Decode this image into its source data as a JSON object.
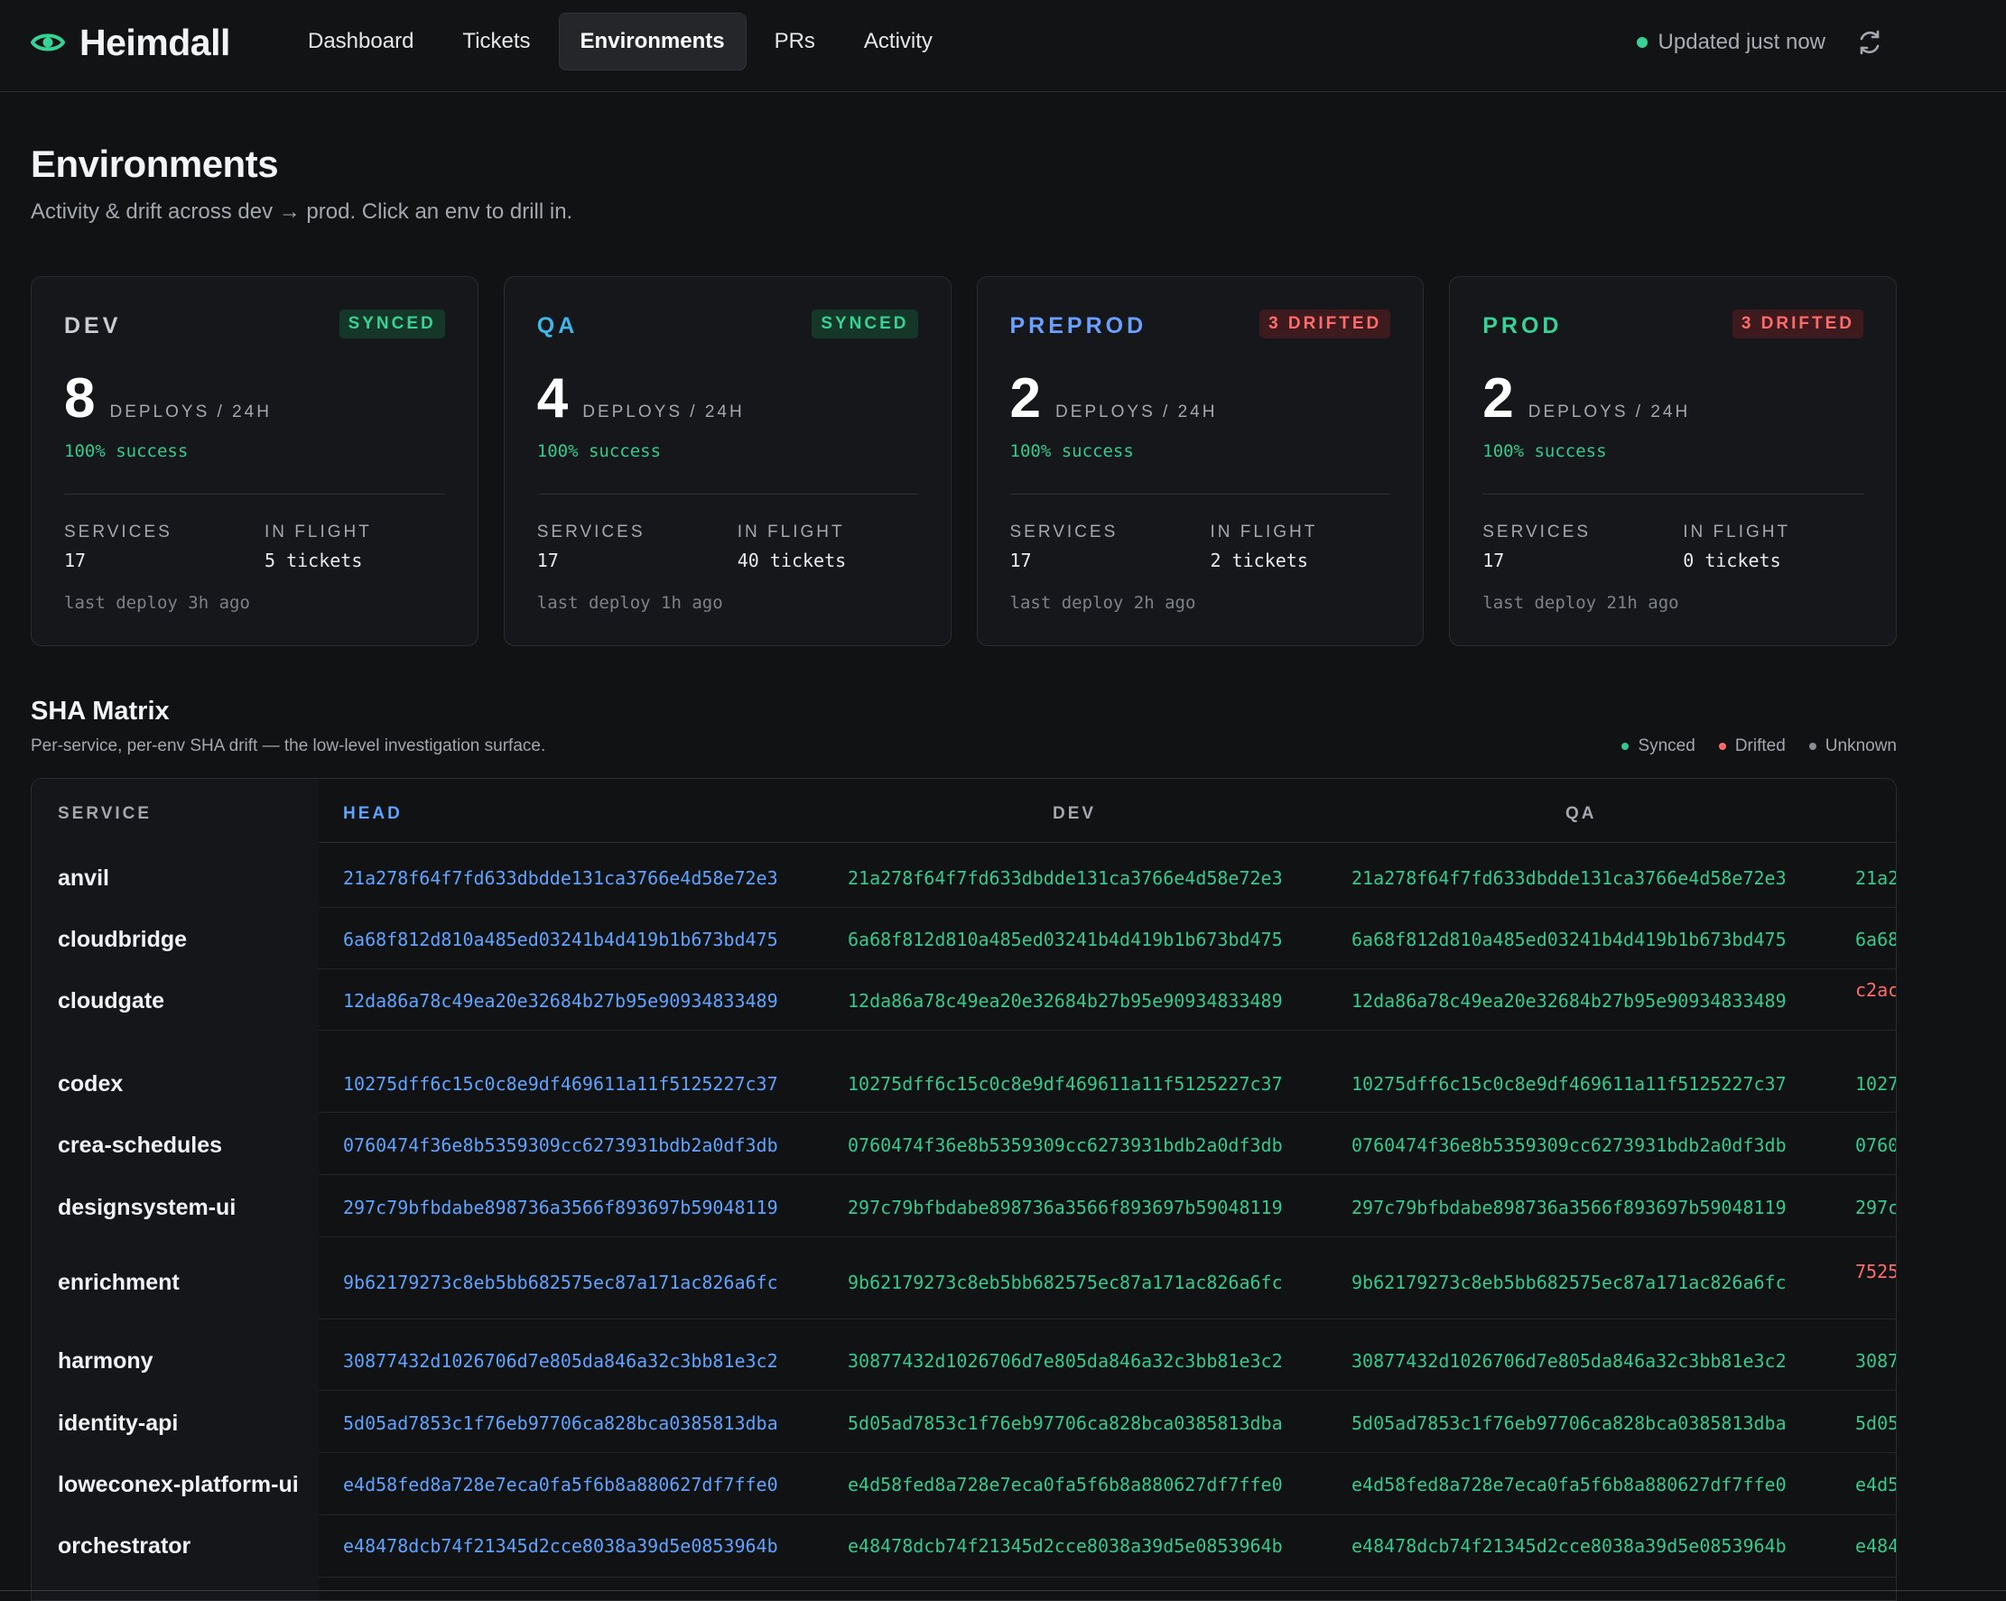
{
  "app": {
    "name": "Heimdall",
    "status": "Updated just now"
  },
  "colors": {
    "accent": "#38d196",
    "head": "#5fa3ff",
    "drifted": "#ff6b6b",
    "unknown": "#8a8d94"
  },
  "nav": [
    {
      "label": "Dashboard"
    },
    {
      "label": "Tickets"
    },
    {
      "label": "Environments",
      "active": true
    },
    {
      "label": "PRs"
    },
    {
      "label": "Activity"
    }
  ],
  "page": {
    "title": "Environments",
    "subtitle": "Activity & drift across dev → prod. Click an env to drill in."
  },
  "envs": [
    {
      "name": "DEV",
      "color": "#c9ccd1",
      "badge": "SYNCED",
      "deploys": "8",
      "deploys_label": "DEPLOYS / 24H",
      "success": "100% success",
      "services_label": "SERVICES",
      "services": "17",
      "inflight_label": "IN FLIGHT",
      "inflight": "5 tickets",
      "last_deploy": "last deploy 3h ago"
    },
    {
      "name": "QA",
      "color": "#3fb6e8",
      "badge": "SYNCED",
      "deploys": "4",
      "deploys_label": "DEPLOYS / 24H",
      "success": "100% success",
      "services_label": "SERVICES",
      "services": "17",
      "inflight_label": "IN FLIGHT",
      "inflight": "40 tickets",
      "last_deploy": "last deploy 1h ago"
    },
    {
      "name": "PREPROD",
      "color": "#6aa0ff",
      "badge": "3 DRIFTED",
      "deploys": "2",
      "deploys_label": "DEPLOYS / 24H",
      "success": "100% success",
      "services_label": "SERVICES",
      "services": "17",
      "inflight_label": "IN FLIGHT",
      "inflight": "2 tickets",
      "last_deploy": "last deploy 2h ago"
    },
    {
      "name": "PROD",
      "color": "#38d196",
      "badge": "3 DRIFTED",
      "deploys": "2",
      "deploys_label": "DEPLOYS / 24H",
      "success": "100% success",
      "services_label": "SERVICES",
      "services": "17",
      "inflight_label": "IN FLIGHT",
      "inflight": "0 tickets",
      "last_deploy": "last deploy 21h ago"
    }
  ],
  "sha_matrix": {
    "title": "SHA Matrix",
    "subtitle": "Per-service, per-env SHA drift — the low-level investigation surface.",
    "legend": [
      {
        "label": "Synced",
        "color": "#35c98e"
      },
      {
        "label": "Drifted",
        "color": "#ff6b6b"
      },
      {
        "label": "Unknown",
        "color": "#8a8d94"
      }
    ],
    "columns": {
      "service": "SERVICE",
      "head": "HEAD",
      "dev": "DEV",
      "qa": "QA"
    },
    "rows": [
      {
        "service": "anvil",
        "head": "21a278f64f7fd633dbdde131ca3766e4d58e72e3",
        "dev": "21a278f64f7fd633dbdde131ca3766e4d58e72e3",
        "qa": "21a278f64f7fd633dbdde131ca3766e4d58e72e3",
        "next": "21a2",
        "next_state": "synced"
      },
      {
        "service": "cloudbridge",
        "head": "6a68f812d810a485ed03241b4d419b1b673bd475",
        "dev": "6a68f812d810a485ed03241b4d419b1b673bd475",
        "qa": "6a68f812d810a485ed03241b4d419b1b673bd475",
        "next": "6a68",
        "next_state": "synced"
      },
      {
        "service": "cloudgate",
        "head": "12da86a78c49ea20e32684b27b95e90934833489",
        "dev": "12da86a78c49ea20e32684b27b95e90934833489",
        "qa": "12da86a78c49ea20e32684b27b95e90934833489",
        "next": "c2ac",
        "next_state": "drifted"
      },
      {
        "service": "codex",
        "head": "10275dff6c15c0c8e9df469611a11f5125227c37",
        "dev": "10275dff6c15c0c8e9df469611a11f5125227c37",
        "qa": "10275dff6c15c0c8e9df469611a11f5125227c37",
        "next": "1027",
        "next_state": "synced"
      },
      {
        "service": "crea-schedules",
        "head": "0760474f36e8b5359309cc6273931bdb2a0df3db",
        "dev": "0760474f36e8b5359309cc6273931bdb2a0df3db",
        "qa": "0760474f36e8b5359309cc6273931bdb2a0df3db",
        "next": "0760",
        "next_state": "synced"
      },
      {
        "service": "designsystem-ui",
        "head": "297c79bfbdabe898736a3566f893697b59048119",
        "dev": "297c79bfbdabe898736a3566f893697b59048119",
        "qa": "297c79bfbdabe898736a3566f893697b59048119",
        "next": "297c",
        "next_state": "synced"
      },
      {
        "service": "enrichment",
        "head": "9b62179273c8eb5bb682575ec87a171ac826a6fc",
        "dev": "9b62179273c8eb5bb682575ec87a171ac826a6fc",
        "qa": "9b62179273c8eb5bb682575ec87a171ac826a6fc",
        "next": "7525",
        "next_state": "drifted"
      },
      {
        "service": "harmony",
        "head": "30877432d1026706d7e805da846a32c3bb81e3c2",
        "dev": "30877432d1026706d7e805da846a32c3bb81e3c2",
        "qa": "30877432d1026706d7e805da846a32c3bb81e3c2",
        "next": "3087",
        "next_state": "synced"
      },
      {
        "service": "identity-api",
        "head": "5d05ad7853c1f76eb97706ca828bca0385813dba",
        "dev": "5d05ad7853c1f76eb97706ca828bca0385813dba",
        "qa": "5d05ad7853c1f76eb97706ca828bca0385813dba",
        "next": "5d05",
        "next_state": "synced"
      },
      {
        "service": "loweconex-platform-ui",
        "head": "e4d58fed8a728e7eca0fa5f6b8a880627df7ffe0",
        "dev": "e4d58fed8a728e7eca0fa5f6b8a880627df7ffe0",
        "qa": "e4d58fed8a728e7eca0fa5f6b8a880627df7ffe0",
        "next": "e4d5",
        "next_state": "synced"
      },
      {
        "service": "orchestrator",
        "head": "e48478dcb74f21345d2cce8038a39d5e0853964b",
        "dev": "e48478dcb74f21345d2cce8038a39d5e0853964b",
        "qa": "e48478dcb74f21345d2cce8038a39d5e0853964b",
        "next": "e484",
        "next_state": "synced"
      }
    ]
  }
}
